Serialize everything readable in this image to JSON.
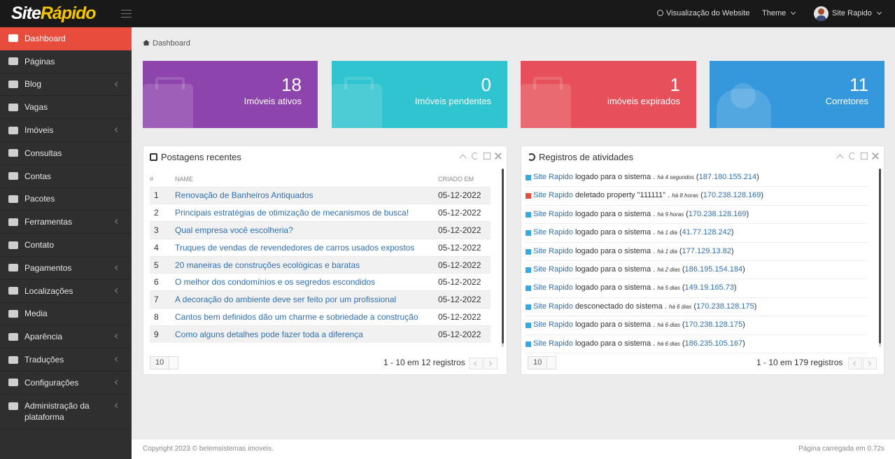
{
  "header": {
    "logo_part1": "Site",
    "logo_part2": "Rápido",
    "view_website": "Visualização do Website",
    "theme": "Theme",
    "user_name": "Site Rapido"
  },
  "sidebar": {
    "items": [
      {
        "label": "Dashboard",
        "icon": "home-icon"
      },
      {
        "label": "Páginas",
        "icon": "book-icon"
      },
      {
        "label": "Blog",
        "icon": "edit-icon"
      },
      {
        "label": "Vagas",
        "icon": "keyboard-icon"
      },
      {
        "label": "Imóveis",
        "icon": "bed-icon"
      },
      {
        "label": "Consultas",
        "icon": "headset-icon"
      },
      {
        "label": "Contas",
        "icon": "users-icon"
      },
      {
        "label": "Pacotes",
        "icon": "id-card-icon"
      },
      {
        "label": "Ferramentas",
        "icon": "tools-icon"
      },
      {
        "label": "Contato",
        "icon": "envelope-icon"
      },
      {
        "label": "Pagamentos",
        "icon": "credit-card-icon"
      },
      {
        "label": "Localizações",
        "icon": "globe-icon"
      },
      {
        "label": "Media",
        "icon": "image-icon"
      },
      {
        "label": "Aparência",
        "icon": "brush-icon"
      },
      {
        "label": "Traduções",
        "icon": "language-icon"
      },
      {
        "label": "Configurações",
        "icon": "cogs-icon"
      },
      {
        "label": "Administração da plataforma",
        "icon": "user-cog-icon"
      }
    ]
  },
  "breadcrumb": {
    "label": "Dashboard"
  },
  "stats": [
    {
      "value": "18",
      "label": "Imóveis ativos",
      "color": "#8e44ad"
    },
    {
      "value": "0",
      "label": "Imóveis pendentes",
      "color": "#2fc4cf"
    },
    {
      "value": "1",
      "label": "imóveis expirados",
      "color": "#e7505a"
    },
    {
      "value": "11",
      "label": "Corretores",
      "color": "#3598dc"
    }
  ],
  "posts": {
    "title": "Postagens recentes",
    "columns": [
      "#",
      "NAME",
      "CRIADO EM"
    ],
    "rows": [
      {
        "n": "1",
        "name": "Renovação de Banheiros Antiquados",
        "date": "05-12-2022"
      },
      {
        "n": "2",
        "name": "Principais estratégias de otimização de mecanismos de busca!",
        "date": "05-12-2022"
      },
      {
        "n": "3",
        "name": "Qual empresa você escolheria?",
        "date": "05-12-2022"
      },
      {
        "n": "4",
        "name": "Truques de vendas de revendedores de carros usados expostos",
        "date": "05-12-2022"
      },
      {
        "n": "5",
        "name": "20 maneiras de construções ecológicas e baratas",
        "date": "05-12-2022"
      },
      {
        "n": "6",
        "name": "O melhor dos condomínios e os segredos escondidos",
        "date": "05-12-2022"
      },
      {
        "n": "7",
        "name": "A decoração do ambiente deve ser feito por um profissional",
        "date": "05-12-2022"
      },
      {
        "n": "8",
        "name": "Cantos bem definidos dão um charme e sobriedade a construção",
        "date": "05-12-2022"
      },
      {
        "n": "9",
        "name": "Como alguns detalhes pode fazer toda a diferença",
        "date": "05-12-2022"
      }
    ],
    "per_page": "10",
    "info": "1 - 10 em 12 registros"
  },
  "activities": {
    "title": "Registros de atividades",
    "rows": [
      {
        "who": "Site Rapido",
        "action": "logado para o sistema",
        "when": "há 4 segundos",
        "ip": "187.180.155.214",
        "color": "#36a9e1"
      },
      {
        "who": "Site Rapido",
        "action": "deletado property \"111111\"",
        "when": "há 8 horas",
        "ip": "170.238.128.169",
        "color": "#e74c3c"
      },
      {
        "who": "Site Rapido",
        "action": "logado para o sistema",
        "when": "há 9 horas",
        "ip": "170.238.128.169",
        "color": "#36a9e1"
      },
      {
        "who": "Site Rapido",
        "action": "logado para o sistema",
        "when": "há 1 dia",
        "ip": "41.77.128.242",
        "color": "#36a9e1"
      },
      {
        "who": "Site Rapido",
        "action": "logado para o sistema",
        "when": "há 1 dia",
        "ip": "177.129.13.82",
        "color": "#36a9e1"
      },
      {
        "who": "Site Rapido",
        "action": "logado para o sistema",
        "when": "há 2 dias",
        "ip": "186.195.154.184",
        "color": "#36a9e1"
      },
      {
        "who": "Site Rapido",
        "action": "logado para o sistema",
        "when": "há 5 dias",
        "ip": "149.19.165.73",
        "color": "#36a9e1"
      },
      {
        "who": "Site Rapido",
        "action": "desconectado do sistema",
        "when": "há 6 dias",
        "ip": "170.238.128.175",
        "color": "#36a9e1"
      },
      {
        "who": "Site Rapido",
        "action": "logado para o sistema",
        "when": "há 6 dias",
        "ip": "170.238.128.175",
        "color": "#36a9e1"
      },
      {
        "who": "Site Rapido",
        "action": "logado para o sistema",
        "when": "há 6 dias",
        "ip": "186.235.105.167",
        "color": "#36a9e1"
      }
    ],
    "per_page": "10",
    "info": "1 - 10 em 179 registros"
  },
  "footer": {
    "copyright": "Copyright 2023 © belemsistemas imoveis.",
    "load_time": "Página carregada em 0.72s"
  }
}
